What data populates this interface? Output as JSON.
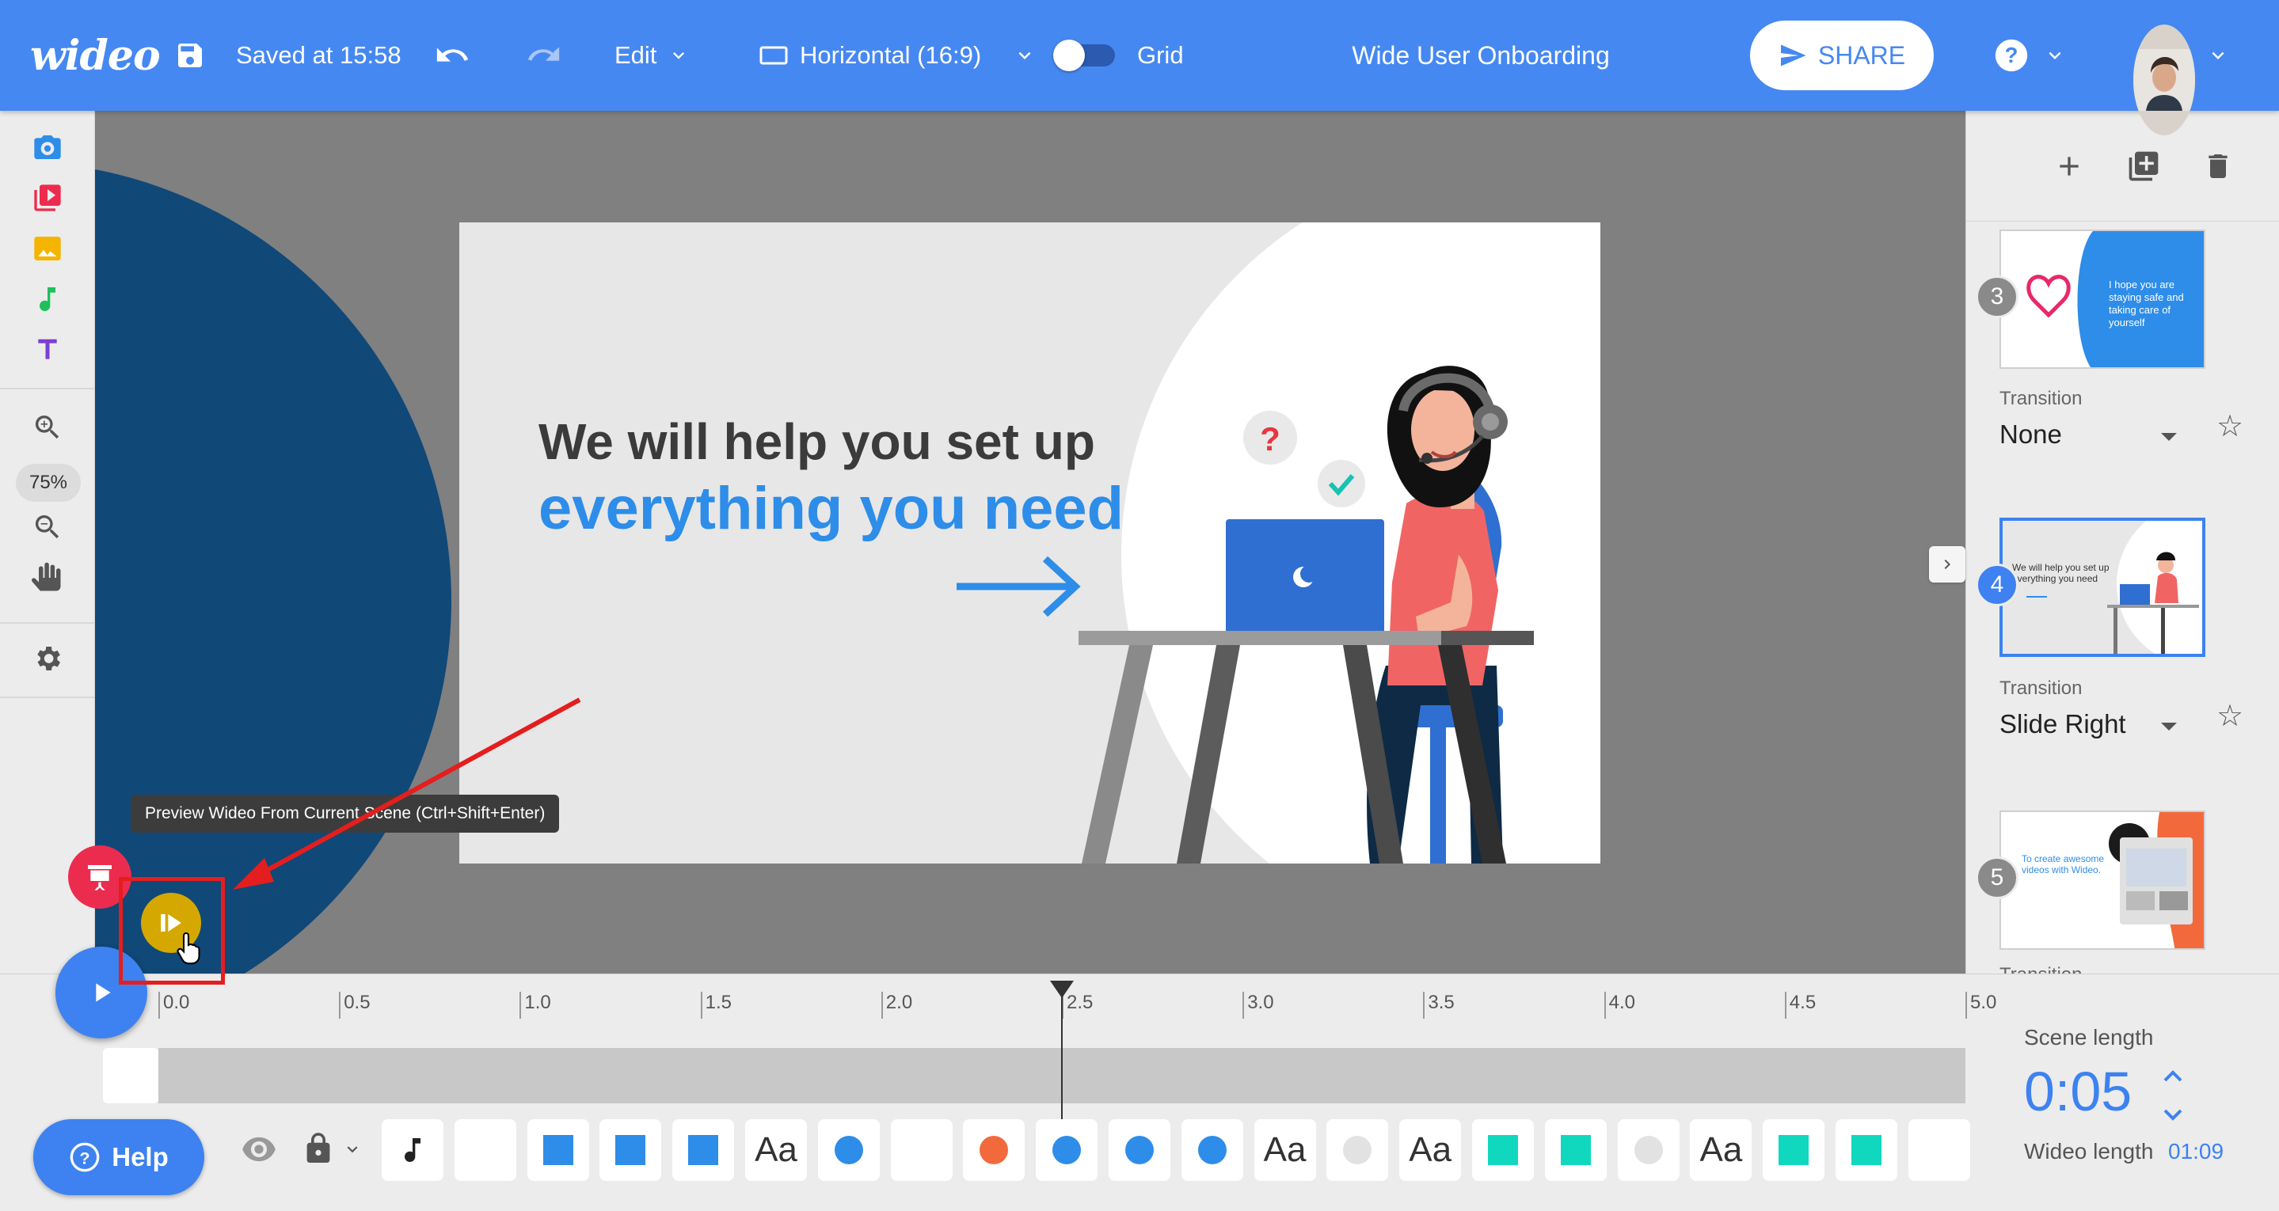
{
  "colors": {
    "topbar": "#4688f1",
    "accent": "#3d82f0",
    "canvas_bg": "#808080",
    "headline_blue": "#2d8de9",
    "highlight_red": "#e41e1e",
    "preview_yellow": "#d4a800"
  },
  "topbar": {
    "logo": "wideo",
    "saved_status": "Saved at 15:58",
    "edit_menu": "Edit",
    "aspect_ratio": "Horizontal (16:9)",
    "grid_label": "Grid",
    "project_title": "Wide User Onboarding",
    "share_label": "SHARE",
    "icons": [
      "save-icon",
      "undo-icon",
      "redo-icon",
      "screen-icon",
      "help-circle-icon",
      "chevron-down-icon"
    ]
  },
  "left_toolbar": {
    "zoom_level": "75%",
    "tools": [
      "camera-icon",
      "video-icon",
      "image-icon",
      "music-icon",
      "text-icon",
      "zoom-in-icon",
      "zoom-out-icon",
      "hand-icon",
      "gear-icon"
    ]
  },
  "slide": {
    "headline_line1": "We will help you set up",
    "headline_line2": "everything you need"
  },
  "tooltip": "Preview Wideo From Current Scene (Ctrl+Shift+Enter)",
  "scenes": [
    {
      "number": "3",
      "thumb_text": "I hope you are staying safe and taking care of yourself",
      "transition_label": "Transition",
      "transition": "None",
      "selected": false
    },
    {
      "number": "4",
      "thumb_text": "We will help you set up everything you need",
      "transition_label": "Transition",
      "transition": "Slide Right",
      "selected": true
    },
    {
      "number": "5",
      "thumb_text": "To create awesome videos with Wideo.",
      "transition_label": "Transition",
      "transition": "",
      "selected": false
    }
  ],
  "timeline": {
    "ruler": [
      "0.0",
      "0.5",
      "1.0",
      "1.5",
      "2.0",
      "2.5",
      "3.0",
      "3.5",
      "4.0",
      "4.5",
      "5.0"
    ],
    "playhead_time": 2.5,
    "scene_length_label": "Scene length",
    "scene_length": "0:05",
    "wideo_length_label": "Wideo length",
    "wideo_length": "01:09",
    "help_label": "Help",
    "layers": [
      "music",
      "blank",
      "square-blue",
      "square-blue",
      "square-blue",
      "Aa",
      "circle-blue",
      "blank",
      "circle-orange",
      "circle-blue",
      "circle-blue",
      "circle-blue",
      "Aa",
      "circle-lightgray",
      "Aa",
      "square-teal",
      "square-teal",
      "circle-lightgray",
      "Aa",
      "square-teal",
      "square-teal",
      "blank"
    ]
  }
}
